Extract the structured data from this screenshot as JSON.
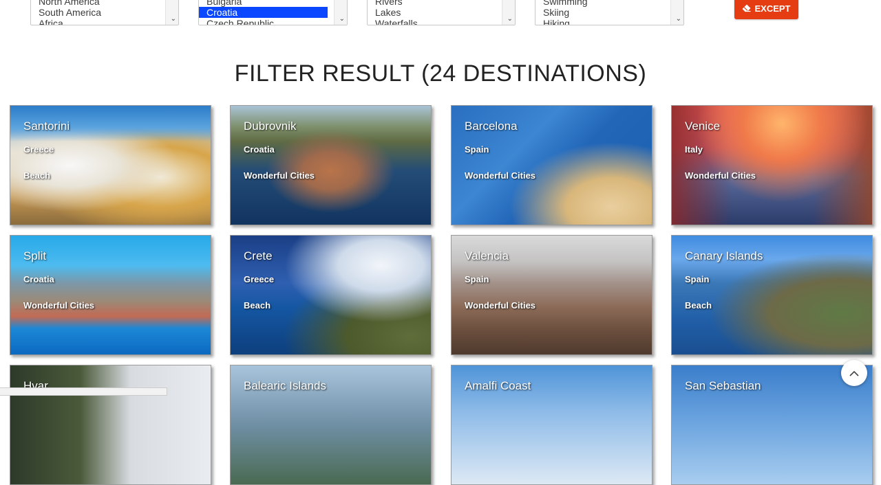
{
  "filters": {
    "regions": {
      "options": [
        "North America",
        "South America",
        "Africa"
      ]
    },
    "countries": {
      "options": [
        "Bulgaria",
        "Croatia",
        "Czech Republic"
      ],
      "selected": "Croatia"
    },
    "nature": {
      "options": [
        "Rivers",
        "Lakes",
        "Waterfalls"
      ]
    },
    "activities": {
      "options": [
        "Swimming",
        "Skiing",
        "Hiking"
      ]
    },
    "except_button": {
      "label": "EXCEPT",
      "icon": "eraser-icon"
    }
  },
  "result_heading": "FILTER RESULT (24 DESTINATIONS)",
  "colors": {
    "accent": "#e63c12",
    "selection": "#0a47ff"
  },
  "destinations": [
    {
      "name": "Santorini",
      "country": "Greece",
      "category": "Beach"
    },
    {
      "name": "Dubrovnik",
      "country": "Croatia",
      "category": "Wonderful Cities"
    },
    {
      "name": "Barcelona",
      "country": "Spain",
      "category": "Wonderful Cities"
    },
    {
      "name": "Venice",
      "country": "Italy",
      "category": "Wonderful Cities"
    },
    {
      "name": "Split",
      "country": "Croatia",
      "category": "Wonderful Cities"
    },
    {
      "name": "Crete",
      "country": "Greece",
      "category": "Beach"
    },
    {
      "name": "Valencia",
      "country": "Spain",
      "category": "Wonderful Cities"
    },
    {
      "name": "Canary Islands",
      "country": "Spain",
      "category": "Beach"
    },
    {
      "name": "Hvar",
      "country": "",
      "category": ""
    },
    {
      "name": "Balearic Islands",
      "country": "",
      "category": ""
    },
    {
      "name": "Amalfi Coast",
      "country": "",
      "category": ""
    },
    {
      "name": "San Sebastian",
      "country": "",
      "category": ""
    }
  ],
  "back_to_top": {
    "icon": "chevron-up-icon"
  }
}
